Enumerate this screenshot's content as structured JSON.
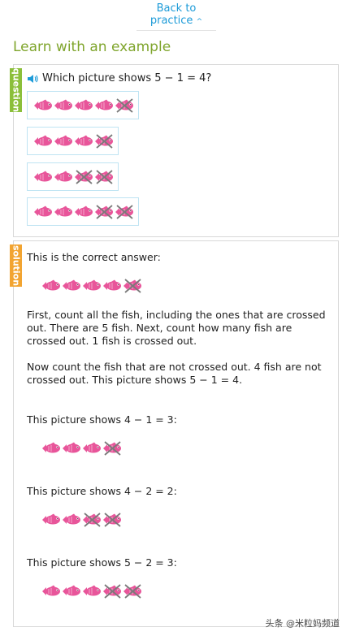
{
  "nav": {
    "back_label": "Back to",
    "back_label2": "practice",
    "caret": "^"
  },
  "section_title": "Learn with an example",
  "question": {
    "tab_label": "question",
    "prompt": "Which picture shows 5 − 1 = 4?",
    "choices": [
      {
        "total": 5,
        "crossed": 1
      },
      {
        "total": 4,
        "crossed": 1
      },
      {
        "total": 4,
        "crossed": 2
      },
      {
        "total": 5,
        "crossed": 2
      }
    ]
  },
  "solution": {
    "tab_label": "solution",
    "intro": "This is the correct answer:",
    "answer": {
      "total": 5,
      "crossed": 1
    },
    "para1": "First, count all the fish, including the ones that are crossed out. There are 5 fish. Next, count how many fish are crossed out. 1 fish is crossed out.",
    "para2": "Now count the fish that are not crossed out. 4 fish are not crossed out. This picture shows 5 − 1 = 4.",
    "others": [
      {
        "text": "This picture shows 4 − 1 = 3:",
        "total": 4,
        "crossed": 1
      },
      {
        "text": "This picture shows 4 − 2 = 2:",
        "total": 4,
        "crossed": 2
      },
      {
        "text": "This picture shows 5 − 2 = 3:",
        "total": 5,
        "crossed": 2
      }
    ]
  },
  "watermark": "头条 @米粒妈频道",
  "colors": {
    "fish": "#e8559a",
    "cross": "#7a7a7a",
    "link": "#1d9bd8",
    "title": "#7fa52c",
    "question_tab": "#8bbf3a",
    "solution_tab": "#f2a431"
  },
  "icons": {
    "speaker": "speaker-icon",
    "fish": "fish-icon",
    "cross": "cross-out-icon",
    "caret": "caret-up-icon"
  }
}
